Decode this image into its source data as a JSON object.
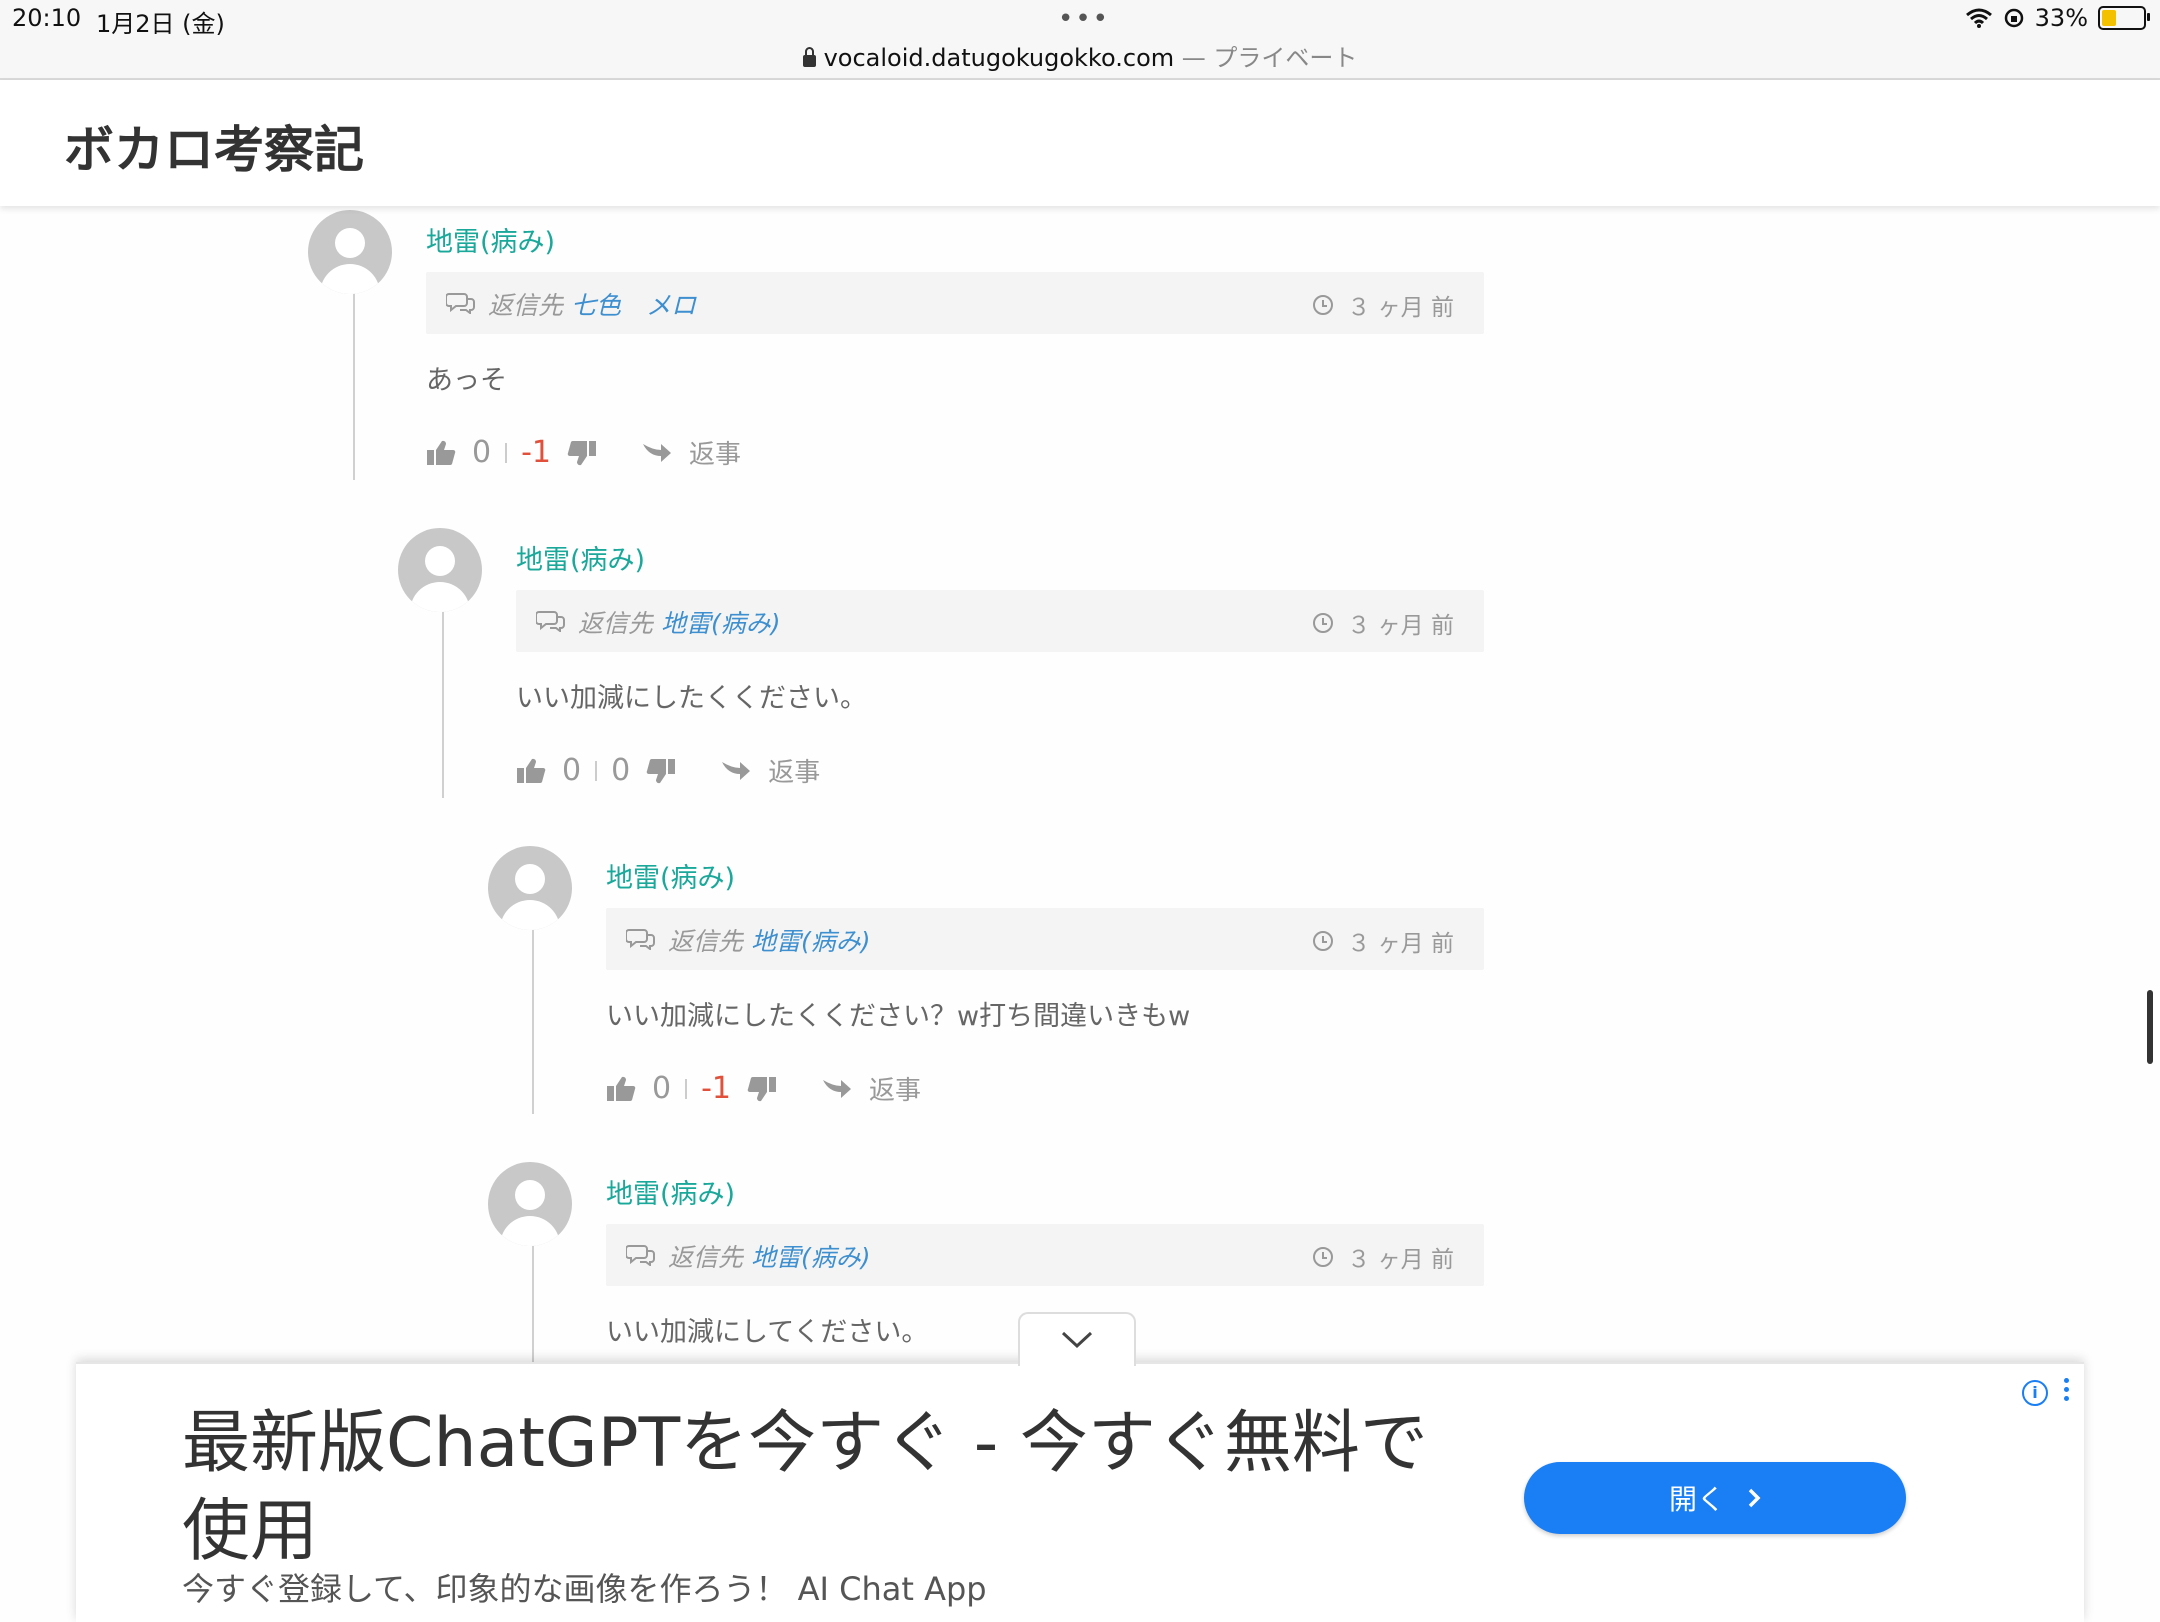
{
  "status_bar": {
    "time": "20:10",
    "date": "1月2日 (金)",
    "dots": "•••",
    "url": "vocaloid.datugokugokko.com",
    "url_suffix": " — プライベート",
    "battery": "33%"
  },
  "site": {
    "title": "ボカロ考察記"
  },
  "reply_prefix": "返信先",
  "reply_label": "返事",
  "comments": [
    {
      "author": "地雷(病み)",
      "reply_to": "七色　メロ",
      "time": "３ ヶ月 前",
      "body": "あっそ",
      "likes": "0",
      "dislikes": "-1"
    },
    {
      "author": "地雷(病み)",
      "reply_to": "地雷(病み)",
      "time": "３ ヶ月 前",
      "body": "いい加減にしたくください。",
      "likes": "0",
      "dislikes": "0"
    },
    {
      "author": "地雷(病み)",
      "reply_to": "地雷(病み)",
      "time": "３ ヶ月 前",
      "body": "いい加減にしたくください？w打ち間違いきもw",
      "likes": "0",
      "dislikes": "-1"
    },
    {
      "author": "地雷(病み)",
      "reply_to": "地雷(病み)",
      "time": "３ ヶ月 前",
      "body": "いい加減にしてください。"
    }
  ],
  "ad": {
    "headline": "最新版ChatGPTを今すぐ - 今すぐ無料で使用",
    "subtext": "今すぐ登録して、印象的な画像を作ろう！ AI Chat App",
    "button_label": "開く",
    "accent_color": "#1a7ef5"
  }
}
